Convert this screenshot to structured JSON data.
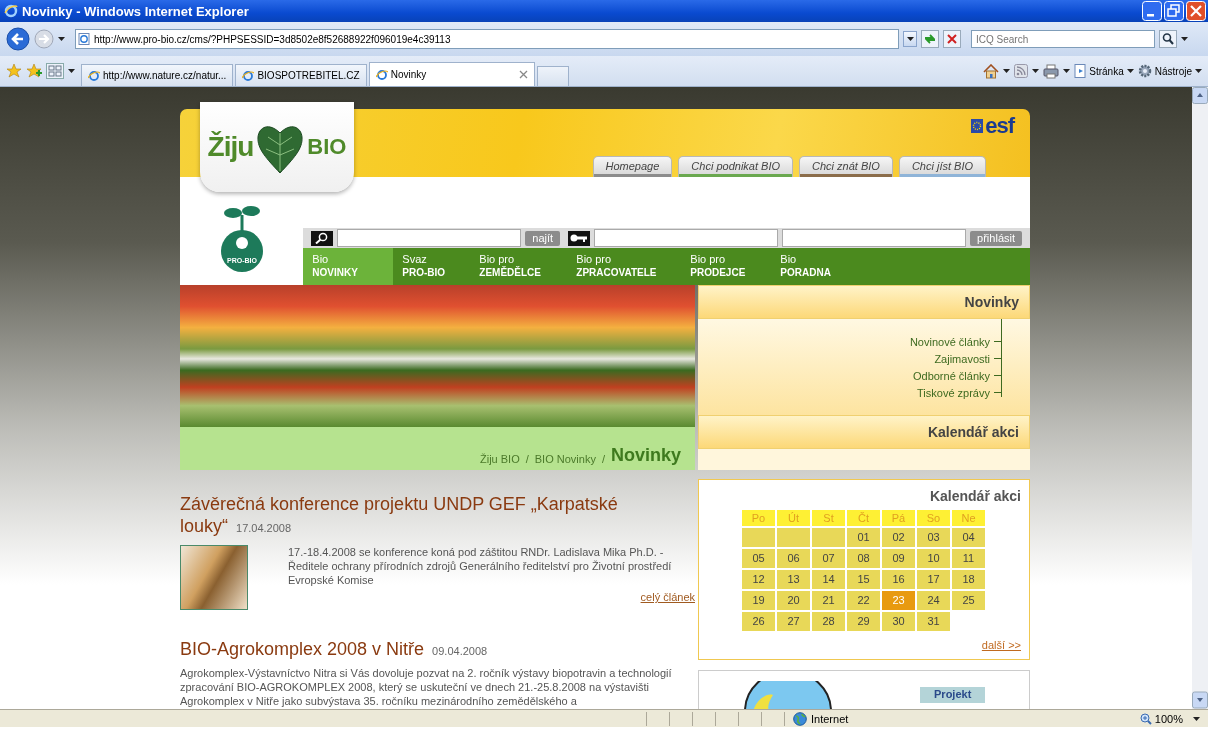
{
  "window": {
    "title": "Novinky - Windows Internet Explorer"
  },
  "address_bar": {
    "url": "http://www.pro-bio.cz/cms/?PHPSESSID=3d8502e8f52688922f096019e4c39113",
    "search_placeholder": "ICQ Search"
  },
  "browser_tabs": [
    {
      "label": "http://www.nature.cz/natur...",
      "selected": false
    },
    {
      "label": "BIOSPOTREBITEL.CZ",
      "selected": false
    },
    {
      "label": "Novinky",
      "selected": true
    }
  ],
  "command_bar": [
    {
      "kind": "page",
      "label": "Stránka"
    },
    {
      "kind": "tools",
      "label": "Nástroje"
    }
  ],
  "site": {
    "logo_left": "Žiju",
    "logo_right": "BIO",
    "esf_logo": "esf",
    "probio_logo": "PRO-BIO",
    "top_tabs": [
      {
        "label": "Homepage",
        "color": "#8c8c8c"
      },
      {
        "label": "Chci podnikat BIO",
        "color": "#6aa84f"
      },
      {
        "label": "Chci znát BIO",
        "color": "#8b6d4a"
      },
      {
        "label": "Chci jíst BIO",
        "color": "#8fb4d8"
      }
    ],
    "search_button": "najít",
    "login_button": "přihlásit",
    "nav": [
      {
        "line1": "Bio",
        "line2": "NOVINKY",
        "selected": true
      },
      {
        "line1": "Svaz",
        "line2": "PRO-BIO",
        "selected": false
      },
      {
        "line1": "Bio pro",
        "line2": "ZEMĚDĚLCE",
        "selected": false
      },
      {
        "line1": "Bio pro",
        "line2": "ZPRACOVATELE",
        "selected": false
      },
      {
        "line1": "Bio pro",
        "line2": "PRODEJCE",
        "selected": false
      },
      {
        "line1": "Bio",
        "line2": "PORADNA",
        "selected": false
      }
    ],
    "breadcrumb": [
      {
        "kind": "link",
        "label": "Žiju BIO"
      },
      {
        "kind": "separator",
        "label": "/"
      },
      {
        "kind": "link",
        "label": "BIO Novinky"
      },
      {
        "kind": "separator",
        "label": "/"
      },
      {
        "kind": "current",
        "label": "Novinky"
      }
    ],
    "side_menu": {
      "title": "Novinky",
      "links": [
        "Novinové články",
        "Zajimavosti",
        "Odborné články",
        "Tiskové zprávy"
      ],
      "section": "Kalendář akci"
    },
    "articles": [
      {
        "title": "Závěrečná konference projektu UNDP GEF „Karpatské louky“",
        "date": "17.04.2008",
        "has_image": true,
        "text": "17.-18.4.2008 se konference koná pod záštitou RNDr. Ladislava Mika Ph.D. - Ředitele ochrany přírodních zdrojů Generálního ředitelství pro Životní prostředí Evropské Komise",
        "more": "celý článek"
      },
      {
        "title": "BIO-Agrokomplex 2008 v Nitře",
        "date": "09.04.2008",
        "has_image": false,
        "text": "Agrokomplex-Výstavníctvo Nitra si Vás dovoluje pozvat na 2. ročník výstavy biopotravin a technologií zpracování BIO-AGROKOMPLEX 2008, který se uskuteční ve dnech 21.-25.8.2008 na výstavišti Agrokomplex v Nitře jako subvýstava 35. ročníku mezinárodního zemědělského a"
      }
    ],
    "calendar": {
      "title": "Kalendář akci",
      "weekdays": [
        "Po",
        "Út",
        "St",
        "Čt",
        "Pá",
        "So",
        "Ne"
      ],
      "days": [
        {
          "kind": "empty"
        },
        {
          "kind": "empty"
        },
        {
          "kind": "empty"
        },
        {
          "kind": "day",
          "label": "01",
          "selected": false
        },
        {
          "kind": "day",
          "label": "02",
          "selected": false
        },
        {
          "kind": "day",
          "label": "03",
          "selected": false
        },
        {
          "kind": "day",
          "label": "04",
          "selected": false
        },
        {
          "kind": "day",
          "label": "05",
          "selected": false
        },
        {
          "kind": "day",
          "label": "06",
          "selected": false
        },
        {
          "kind": "day",
          "label": "07",
          "selected": false
        },
        {
          "kind": "day",
          "label": "08",
          "selected": false
        },
        {
          "kind": "day",
          "label": "09",
          "selected": false
        },
        {
          "kind": "day",
          "label": "10",
          "selected": false
        },
        {
          "kind": "day",
          "label": "11",
          "selected": false
        },
        {
          "kind": "day",
          "label": "12",
          "selected": false
        },
        {
          "kind": "day",
          "label": "13",
          "selected": false
        },
        {
          "kind": "day",
          "label": "14",
          "selected": false
        },
        {
          "kind": "day",
          "label": "15",
          "selected": false
        },
        {
          "kind": "day",
          "label": "16",
          "selected": false
        },
        {
          "kind": "day",
          "label": "17",
          "selected": false
        },
        {
          "kind": "day",
          "label": "18",
          "selected": false
        },
        {
          "kind": "day",
          "label": "19",
          "selected": false
        },
        {
          "kind": "day",
          "label": "20",
          "selected": false
        },
        {
          "kind": "day",
          "label": "21",
          "selected": false
        },
        {
          "kind": "day",
          "label": "22",
          "selected": false
        },
        {
          "kind": "day",
          "label": "23",
          "selected": true
        },
        {
          "kind": "day",
          "label": "24",
          "selected": false
        },
        {
          "kind": "day",
          "label": "25",
          "selected": false
        },
        {
          "kind": "day",
          "label": "26",
          "selected": false
        },
        {
          "kind": "day",
          "label": "27",
          "selected": false
        },
        {
          "kind": "day",
          "label": "28",
          "selected": false
        },
        {
          "kind": "day",
          "label": "29",
          "selected": false
        },
        {
          "kind": "day",
          "label": "30",
          "selected": false
        },
        {
          "kind": "day",
          "label": "31",
          "selected": false
        }
      ],
      "more": "další >>"
    },
    "promo": {
      "label": "Projekt"
    }
  },
  "status_bar": {
    "zone": "Internet",
    "zoom": "100%"
  }
}
